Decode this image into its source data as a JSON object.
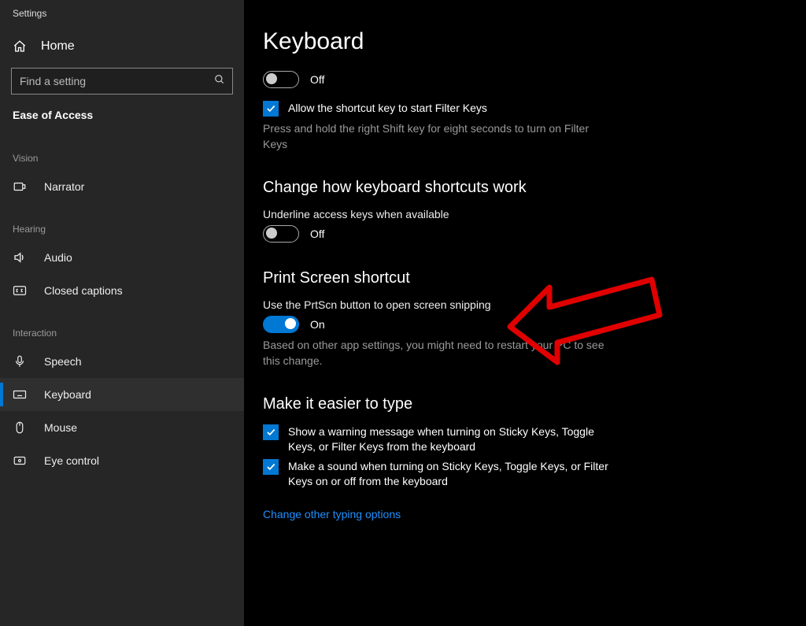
{
  "window": {
    "title": "Settings"
  },
  "sidebar": {
    "home_label": "Home",
    "search_placeholder": "Find a setting",
    "section_label": "Ease of Access",
    "cat_vision": "Vision",
    "cat_hearing": "Hearing",
    "cat_interaction": "Interaction",
    "items": {
      "narrator": "Narrator",
      "audio": "Audio",
      "closed_captions": "Closed captions",
      "speech": "Speech",
      "keyboard": "Keyboard",
      "mouse": "Mouse",
      "eye_control": "Eye control"
    }
  },
  "page": {
    "title": "Keyboard",
    "filter_toggle_state": "Off",
    "filter_checkbox_label": "Allow the shortcut key to start Filter Keys",
    "filter_hint": "Press and hold the right Shift key for eight seconds to turn on Filter Keys",
    "shortcuts_heading": "Change how keyboard shortcuts work",
    "underline_body": "Underline access keys when available",
    "underline_toggle_state": "Off",
    "prtscn_heading": "Print Screen shortcut",
    "prtscn_body": "Use the PrtScn button to open screen snipping",
    "prtscn_toggle_state": "On",
    "prtscn_hint": "Based on other app settings, you might need to restart your PC to see this change.",
    "easier_heading": "Make it easier to type",
    "easier_chk1": "Show a warning message when turning on Sticky Keys, Toggle Keys, or Filter Keys from the keyboard",
    "easier_chk2": "Make a sound when turning on Sticky Keys, Toggle Keys, or Filter Keys on or off from the keyboard",
    "link_other": "Change other typing options"
  },
  "toggles": {
    "filter_keys": false,
    "underline_access": false,
    "prtscn": true
  },
  "checkboxes": {
    "filter_allow": true,
    "easier_warn": true,
    "easier_sound": true
  }
}
